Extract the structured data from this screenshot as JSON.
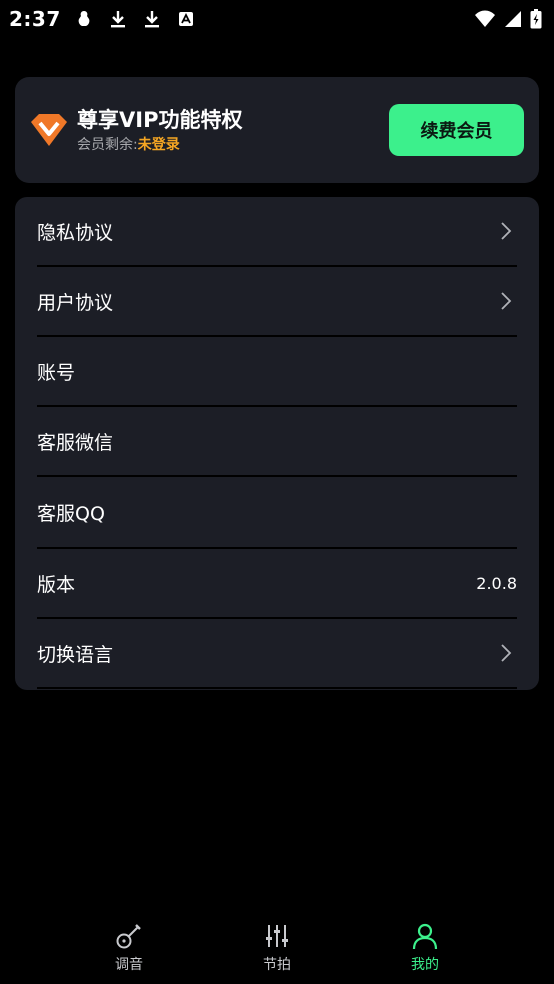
{
  "status_bar": {
    "time": "2:37",
    "icons": [
      "notification-icon",
      "download-icon",
      "download-icon",
      "app-icon",
      "wifi-icon",
      "signal-icon",
      "battery-icon"
    ]
  },
  "vip": {
    "title": "尊享VIP功能特权",
    "remaining_label": "会员剩余:",
    "remaining_value": "未登录",
    "renew_label": "续费会员",
    "accent_color": "#3cf08c",
    "status_color": "#f5a623"
  },
  "menu": {
    "items": [
      {
        "label": "隐私协议",
        "value": "",
        "chevron": true
      },
      {
        "label": "用户协议",
        "value": "",
        "chevron": true
      },
      {
        "label": "账号",
        "value": "",
        "chevron": false
      },
      {
        "label": "客服微信",
        "value": "",
        "chevron": false
      },
      {
        "label": "客服QQ",
        "value": "",
        "chevron": false
      },
      {
        "label": "版本",
        "value": "2.0.8",
        "chevron": false
      },
      {
        "label": "切换语言",
        "value": "",
        "chevron": true
      }
    ]
  },
  "bottom_nav": {
    "items": [
      {
        "label": "调音",
        "icon": "guitar-icon",
        "active": false
      },
      {
        "label": "节拍",
        "icon": "sliders-icon",
        "active": false
      },
      {
        "label": "我的",
        "icon": "user-icon",
        "active": true
      }
    ]
  }
}
